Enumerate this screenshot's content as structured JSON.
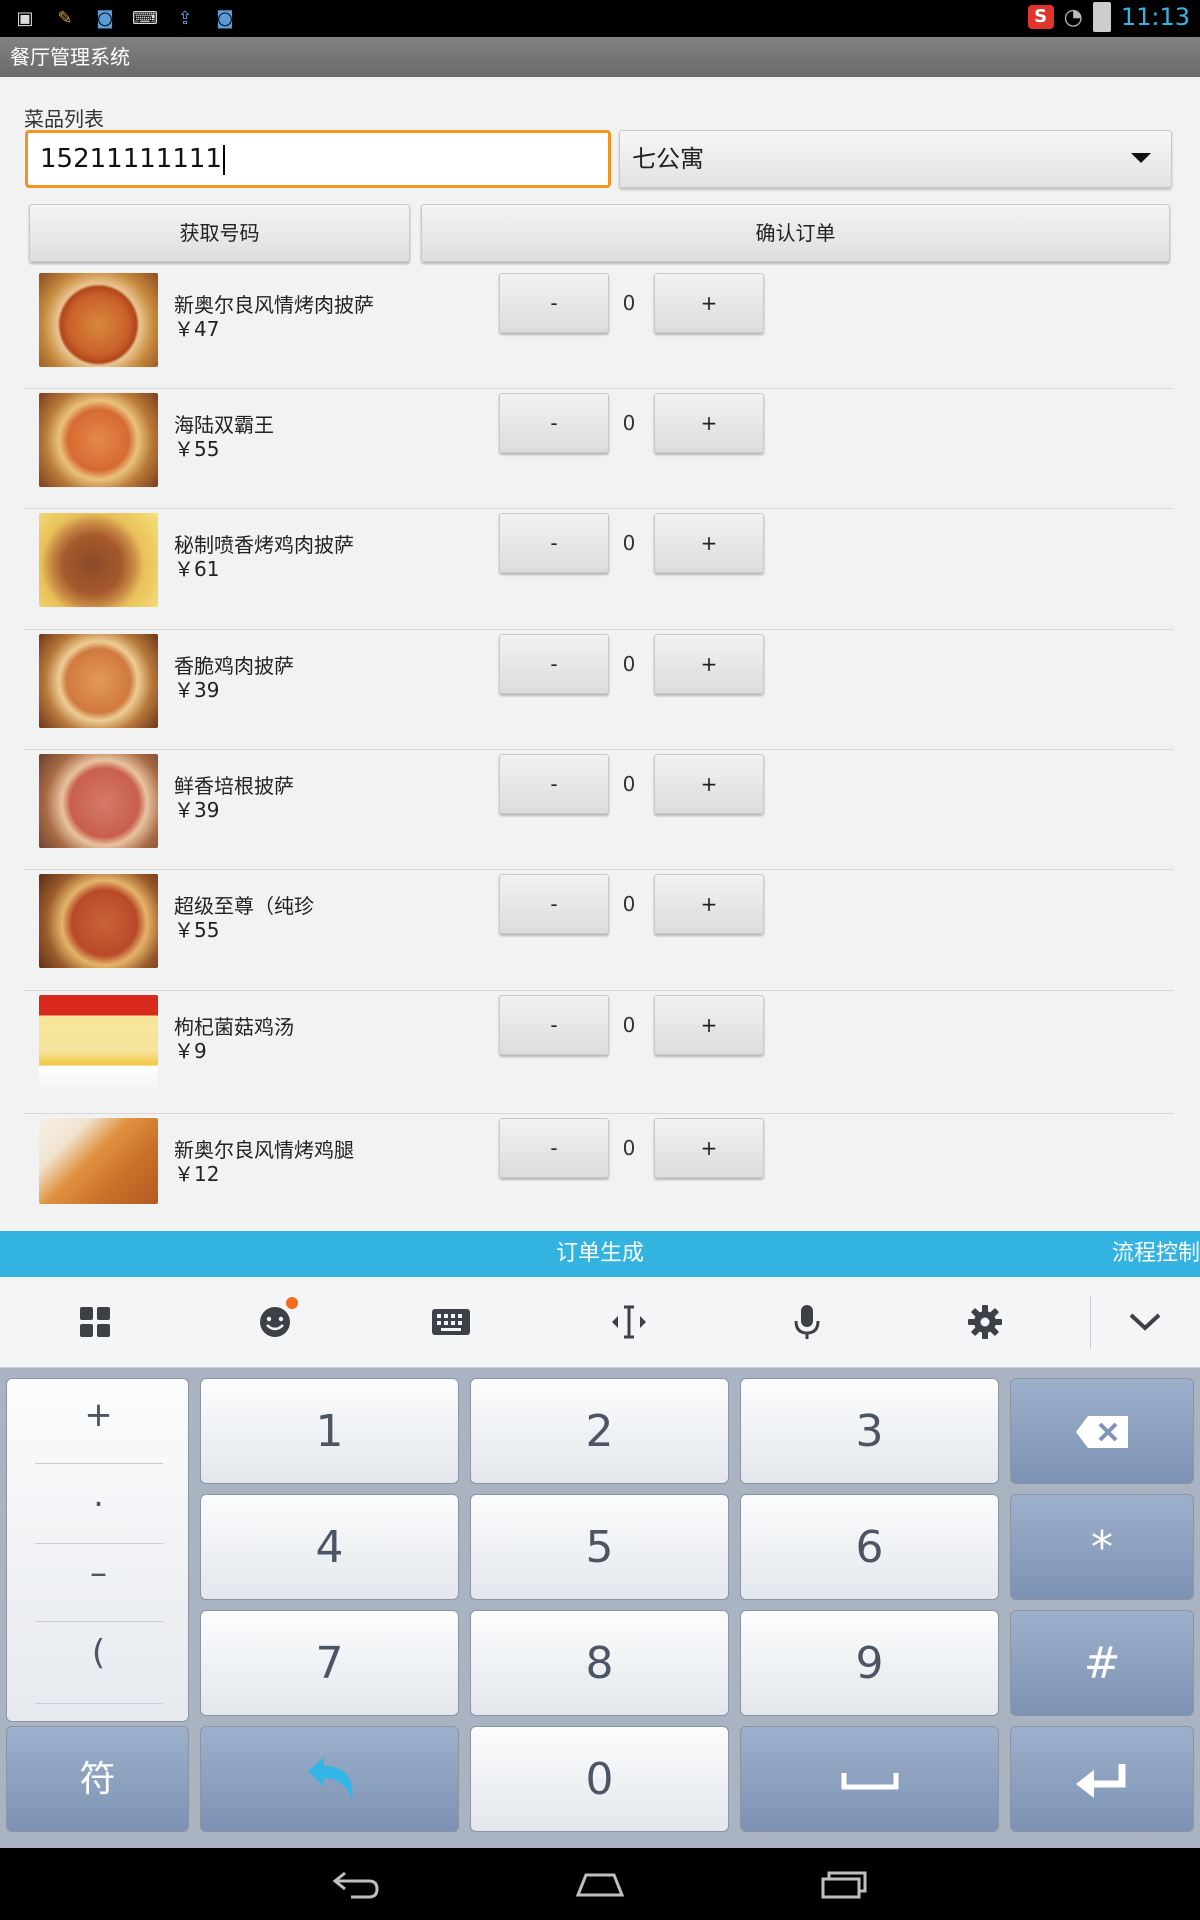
{
  "status_bar": {
    "time": "11:13",
    "left_icons": [
      "image-icon",
      "broom-icon",
      "app-icon",
      "keyboard-icon",
      "upload-icon",
      "app-icon"
    ],
    "sogou_badge": "S"
  },
  "app": {
    "title": "餐厅管理系统"
  },
  "form": {
    "section_label": "菜品列表",
    "phone_value": "15211111111",
    "location_selected": "七公寓",
    "get_number_button": "获取号码",
    "confirm_order_button": "确认订单"
  },
  "dishes": [
    {
      "name": "新奥尔良风情烤肉披萨",
      "price": "￥47",
      "qty": "0",
      "minus": "-",
      "plus": "+"
    },
    {
      "name": "海陆双霸王",
      "price": "￥55",
      "qty": "0",
      "minus": "-",
      "plus": "+"
    },
    {
      "name": "秘制喷香烤鸡肉披萨",
      "price": "￥61",
      "qty": "0",
      "minus": "-",
      "plus": "+"
    },
    {
      "name": "香脆鸡肉披萨",
      "price": "￥39",
      "qty": "0",
      "minus": "-",
      "plus": "+"
    },
    {
      "name": "鲜香培根披萨",
      "price": "￥39",
      "qty": "0",
      "minus": "-",
      "plus": "+"
    },
    {
      "name": "超级至尊（纯珍",
      "price": "￥55",
      "qty": "0",
      "minus": "-",
      "plus": "+"
    },
    {
      "name": "枸杞菌菇鸡汤",
      "price": "￥9",
      "qty": "0",
      "minus": "-",
      "plus": "+"
    },
    {
      "name": "新奥尔良风情烤鸡腿",
      "price": "￥12",
      "qty": "0",
      "minus": "-",
      "plus": "+"
    }
  ],
  "tabs": {
    "order": "订单生成",
    "flow": "流程控制"
  },
  "keyboard": {
    "symbols": [
      "+",
      ".",
      "–",
      "("
    ],
    "digits": [
      "1",
      "2",
      "3",
      "4",
      "5",
      "6",
      "7",
      "8",
      "9",
      "0"
    ],
    "star": "*",
    "hash": "#",
    "fu": "符"
  }
}
